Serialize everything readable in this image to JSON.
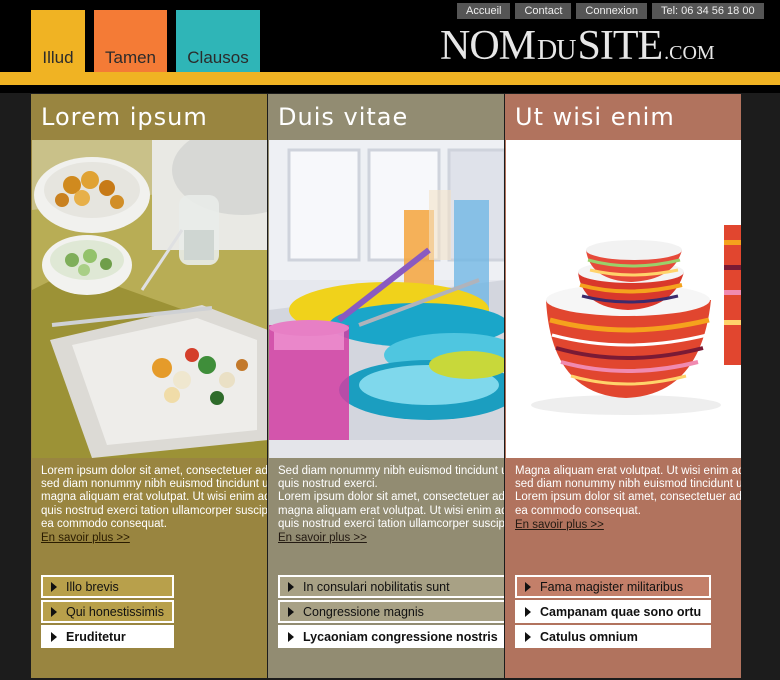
{
  "nav": {
    "tabs": [
      {
        "label": "Illud"
      },
      {
        "label": "Tamen"
      },
      {
        "label": "Clausos"
      }
    ],
    "toplinks": [
      {
        "label": "Accueil"
      },
      {
        "label": "Contact"
      },
      {
        "label": "Connexion"
      },
      {
        "label": "Tel: 06 34 56 18 00"
      }
    ]
  },
  "logo": {
    "part1": "NOM",
    "part2": "DU",
    "part3": "SITE",
    "part4": ".COM"
  },
  "colors": {
    "gold": "#f0b323",
    "orange": "#f47b36",
    "teal": "#2fb5b7",
    "col1": "#998540",
    "col2": "#928c72",
    "col3": "#b1735e"
  },
  "columns": [
    {
      "title": "Lorem ipsum",
      "image": "table-setting-food-photo",
      "lines": [
        "Lorem ipsum dolor sit amet, consectetuer adi",
        "sed diam nonummy nibh euismod tincidunt ut",
        "magna aliquam erat volutpat. Ut wisi enim ad",
        "quis nostrud exerci tation ullamcorper suscipi",
        "ea commodo consequat."
      ],
      "more": "En savoir plus >>",
      "buttons": [
        {
          "label": "Illo brevis",
          "style": "outline"
        },
        {
          "label": "Qui honestissimis",
          "style": "outline"
        },
        {
          "label": "Eruditetur",
          "style": "solid"
        }
      ]
    },
    {
      "title": "Duis vitae",
      "image": "colorful-glassware-photo",
      "lines": [
        "Sed diam nonummy nibh euismod tincidunt ut",
        "quis nostrud exerci.",
        "Lorem ipsum dolor sit amet, consectetuer adi",
        "magna aliquam erat volutpat. Ut wisi enim ad",
        "quis nostrud exerci tation ullamcorper suscipi"
      ],
      "more": "En savoir plus >>",
      "buttons": [
        {
          "label": "In consulari nobilitatis sunt",
          "style": "outline"
        },
        {
          "label": "Congressione magnis",
          "style": "outline"
        },
        {
          "label": "Lycaoniam congressione nostris",
          "style": "solid"
        }
      ]
    },
    {
      "title": "Ut wisi enim",
      "image": "striped-bowls-photo",
      "lines": [
        "Magna aliquam erat volutpat. Ut wisi enim ad",
        "sed diam nonummy nibh euismod tincidunt ut",
        "Lorem ipsum dolor sit amet, consectetuer adi",
        "ea commodo consequat."
      ],
      "more": "En savoir plus >>",
      "buttons": [
        {
          "label": "Fama magister militaribus",
          "style": "outline"
        },
        {
          "label": "Campanam quae sono ortu",
          "style": "solid"
        },
        {
          "label": "Catulus omnium",
          "style": "solid"
        }
      ]
    }
  ]
}
